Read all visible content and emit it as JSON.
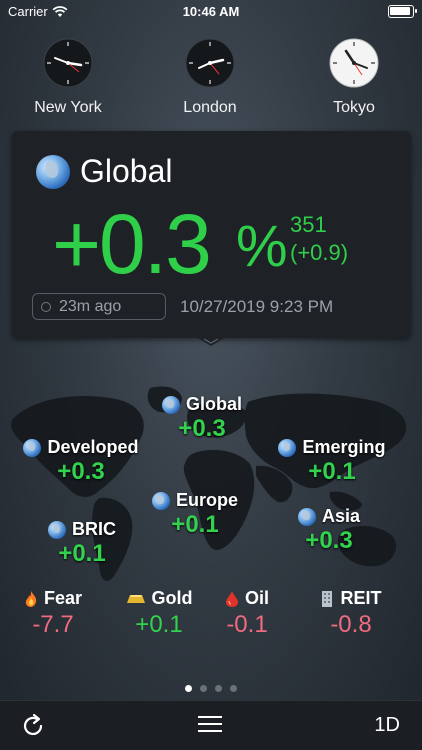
{
  "status_bar": {
    "carrier": "Carrier",
    "time": "10:46 AM"
  },
  "clocks": [
    {
      "city": "New York",
      "theme": "dark"
    },
    {
      "city": "London",
      "theme": "dark"
    },
    {
      "city": "Tokyo",
      "theme": "light"
    }
  ],
  "summary": {
    "title": "Global",
    "change": "+0.3",
    "unit": "%",
    "value": "351",
    "value_change": "(+0.9)",
    "age": "23m ago",
    "timestamp": "10/27/2019 9:23 PM"
  },
  "regions": [
    {
      "id": "global",
      "name": "Global",
      "change": "+0.3"
    },
    {
      "id": "developed",
      "name": "Developed",
      "change": "+0.3"
    },
    {
      "id": "emerging",
      "name": "Emerging",
      "change": "+0.1"
    },
    {
      "id": "europe",
      "name": "Europe",
      "change": "+0.1"
    },
    {
      "id": "bric",
      "name": "BRIC",
      "change": "+0.1"
    },
    {
      "id": "asia",
      "name": "Asia",
      "change": "+0.3"
    }
  ],
  "indicators": [
    {
      "name": "Fear",
      "change": "-7.7",
      "icon": "flame-icon"
    },
    {
      "name": "Gold",
      "change": "+0.1",
      "icon": "gold-bar-icon"
    },
    {
      "name": "Oil",
      "change": "-0.1",
      "icon": "oil-drop-icon"
    },
    {
      "name": "REIT",
      "change": "-0.8",
      "icon": "building-icon"
    }
  ],
  "pager": {
    "count": 4,
    "active": 0
  },
  "toolbar": {
    "range_label": "1D"
  },
  "colors": {
    "positive": "#2fcf4a",
    "negative": "#f06b7e",
    "card": "#1e2226"
  }
}
